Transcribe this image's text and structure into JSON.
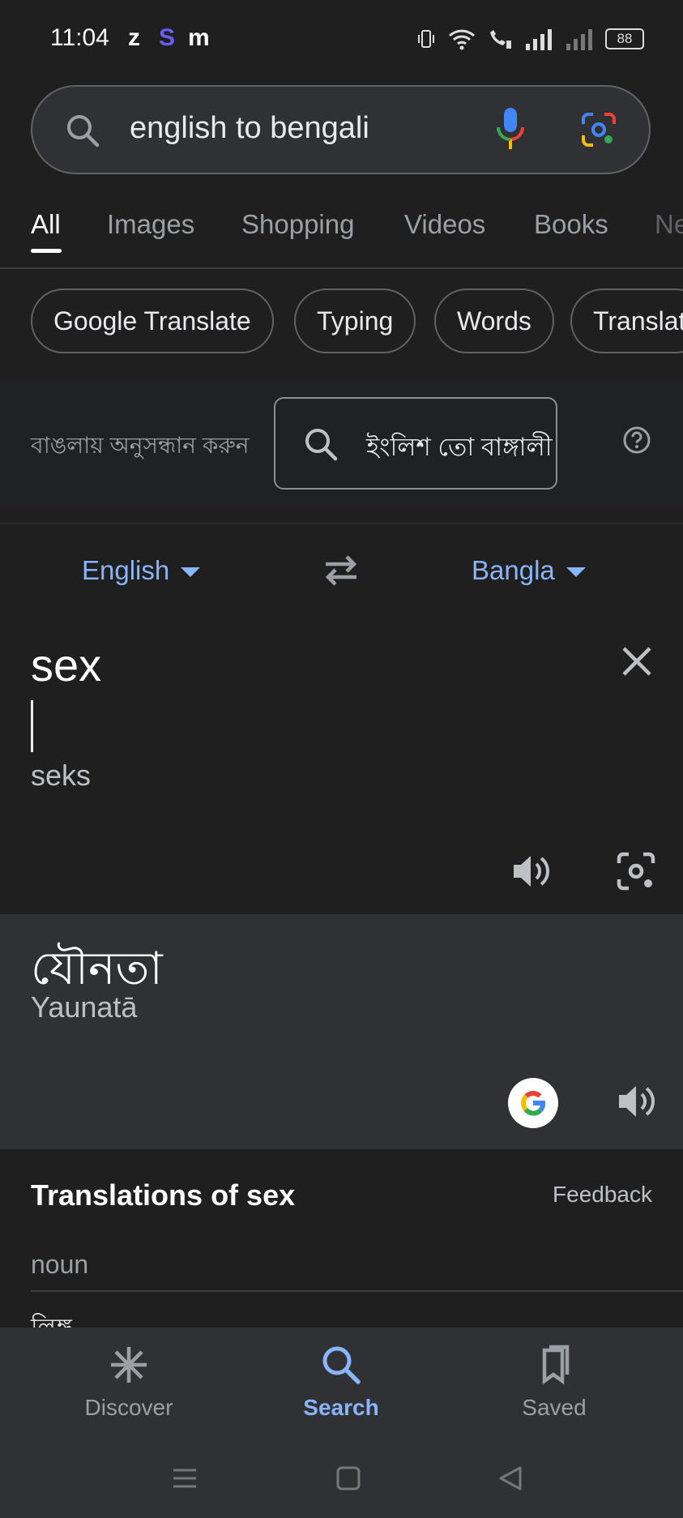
{
  "status_bar": {
    "time": "11:04",
    "apps": [
      "z",
      "S",
      "m"
    ],
    "battery": "88"
  },
  "search": {
    "query": "english to bengali"
  },
  "tabs": [
    {
      "label": "All",
      "active": true
    },
    {
      "label": "Images"
    },
    {
      "label": "Shopping"
    },
    {
      "label": "Videos"
    },
    {
      "label": "Books"
    },
    {
      "label": "Ne"
    }
  ],
  "chips": [
    "Google Translate",
    "Typing",
    "Words",
    "Translat"
  ],
  "bengali_search": {
    "label": "বাঙলায় অনুসন্ধান করুন",
    "query": "ইংলিশ তো বাঙ্গালী"
  },
  "translator": {
    "source_lang": "English",
    "target_lang": "Bangla",
    "source_text": "sex",
    "source_translit": "seks",
    "target_text": "যৌনতা",
    "target_translit": "Yaunatā"
  },
  "translations": {
    "title": "Translations of sex",
    "feedback": "Feedback",
    "part_of_speech": "noun",
    "first_word": "লিঙ্গ"
  },
  "bottom_nav": [
    {
      "label": "Discover"
    },
    {
      "label": "Search",
      "active": true
    },
    {
      "label": "Saved"
    }
  ],
  "colors": {
    "accent": "#8ab4f8",
    "background": "#1f1f1f"
  }
}
